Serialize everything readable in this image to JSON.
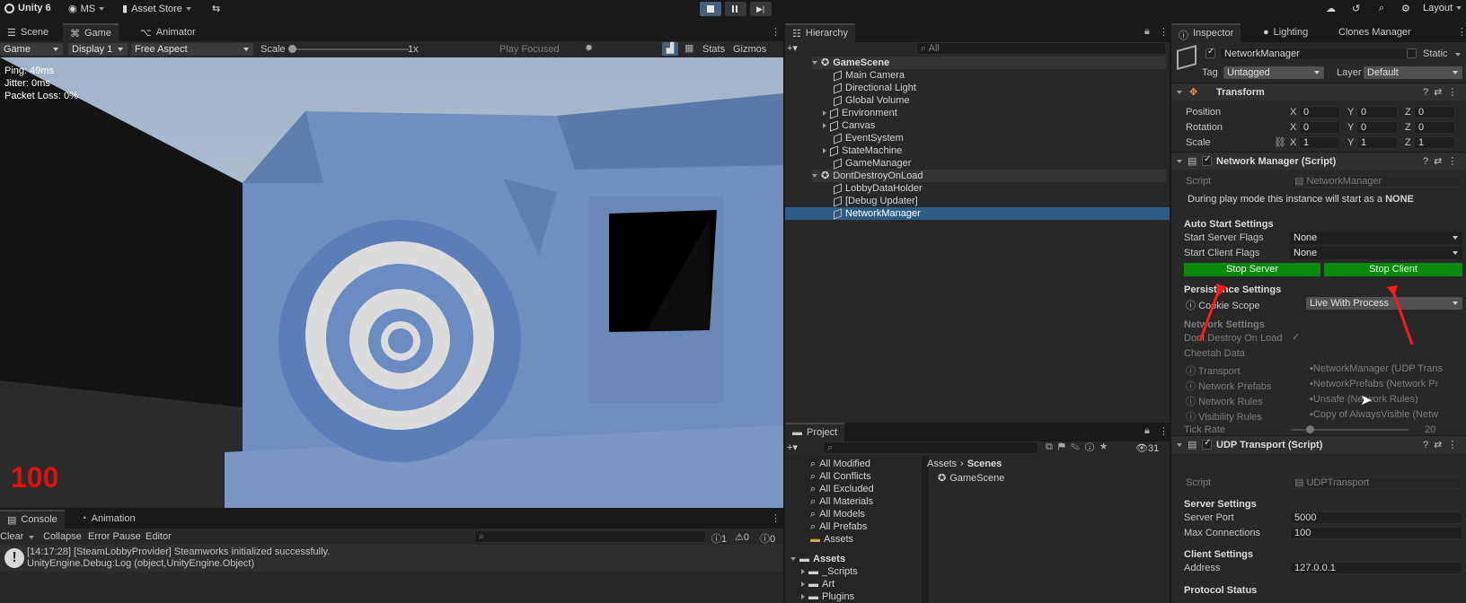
{
  "topbar": {
    "app": "Unity 6",
    "account": "MS",
    "asset_store": "Asset Store",
    "layout": "Layout"
  },
  "game": {
    "tabs": [
      "Scene",
      "Game",
      "Animator"
    ],
    "toolbar": {
      "mode": "Game",
      "display": "Display 1",
      "aspect": "Free Aspect",
      "scale_label": "Scale",
      "scale_value": "1x",
      "play_focused": "Play Focused",
      "stats": "Stats",
      "gizmos": "Gizmos"
    },
    "overlay": {
      "ping": "Ping: 49ms",
      "jitter": "Jitter: 0ms",
      "packet_loss": "Packet Loss: 0%",
      "health": "100"
    }
  },
  "console": {
    "tabs": [
      "Console",
      "Animation"
    ],
    "toolbar": {
      "clear": "Clear",
      "collapse": "Collapse",
      "error_pause": "Error Pause",
      "editor": "Editor",
      "err_count": "1",
      "warn_count": "0",
      "info_count": "0"
    },
    "entry_line1": "[14:17:28] [SteamLobbyProvider] Steamworks initialized successfully.",
    "entry_line2": "UnityEngine.Debug:Log (object,UnityEngine.Object)"
  },
  "hierarchy": {
    "tab": "Hierarchy",
    "search_placeholder": "All",
    "scene1": "GameScene",
    "scene1_items": [
      "Main Camera",
      "Directional Light",
      "Global Volume",
      "Environment",
      "Canvas",
      "EventSystem",
      "StateMachine",
      "GameManager"
    ],
    "scene2": "DontDestroyOnLoad",
    "scene2_items": [
      "LobbyDataHolder",
      "[Debug Updater]",
      "NetworkManager"
    ]
  },
  "project": {
    "tab": "Project",
    "count": "31",
    "favorites": [
      "All Modified",
      "All Conflicts",
      "All Excluded",
      "All Materials",
      "All Models",
      "All Prefabs",
      "Assets"
    ],
    "assets_root": "Assets",
    "folders": [
      "_Scripts",
      "Art",
      "Plugins"
    ],
    "breadcrumb": [
      "Assets",
      "Scenes"
    ],
    "files": [
      "GameScene"
    ]
  },
  "inspector": {
    "tabs": [
      "Inspector",
      "Lighting",
      "Clones Manager"
    ],
    "object_name": "NetworkManager",
    "static": "Static",
    "tag_label": "Tag",
    "tag": "Untagged",
    "layer_label": "Layer",
    "layer": "Default",
    "transform": {
      "title": "Transform",
      "position": "Position",
      "rotation": "Rotation",
      "scale": "Scale",
      "pos": [
        "0",
        "0",
        "0"
      ],
      "rot": [
        "0",
        "0",
        "0"
      ],
      "scl": [
        "1",
        "1",
        "1"
      ]
    },
    "nm": {
      "title": "Network Manager (Script)",
      "script_label": "Script",
      "script": "NetworkManager",
      "info_pre": "During play mode this instance will start as a ",
      "info_bold": "NONE",
      "auto_start": "Auto Start Settings",
      "server_flags_label": "Start Server Flags",
      "server_flags": "None",
      "client_flags_label": "Start Client Flags",
      "client_flags": "None",
      "stop_server": "Stop Server",
      "stop_client": "Stop Client",
      "persistence": "Persistence Settings",
      "cookie_label": "Cookie Scope",
      "cookie": "Live With Process",
      "network_settings": "Network Settings",
      "dont_destroy": "Dont Destroy On Load",
      "cheetah": "Cheetah Data",
      "transport_label": "Transport",
      "transport": "NetworkManager (UDP Trans",
      "prefabs_label": "Network Prefabs",
      "prefabs": "NetworkPrefabs (Network Pr",
      "rules_label": "Network Rules",
      "rules": "Unsafe (Network Rules)",
      "visibility_label": "Visibility Rules",
      "visibility": "Copy of AlwaysVisible (Netw",
      "tick_label": "Tick Rate",
      "tick": "20",
      "tick_fraction": 0.15
    },
    "udp": {
      "title": "UDP Transport (Script)",
      "script_label": "Script",
      "script": "UDPTransport",
      "server_settings": "Server Settings",
      "port_label": "Server Port",
      "port": "5000",
      "maxconn_label": "Max Connections",
      "maxconn": "100",
      "client_settings": "Client Settings",
      "address_label": "Address",
      "address": "127.0.0.1",
      "protocol": "Protocol Status"
    }
  }
}
